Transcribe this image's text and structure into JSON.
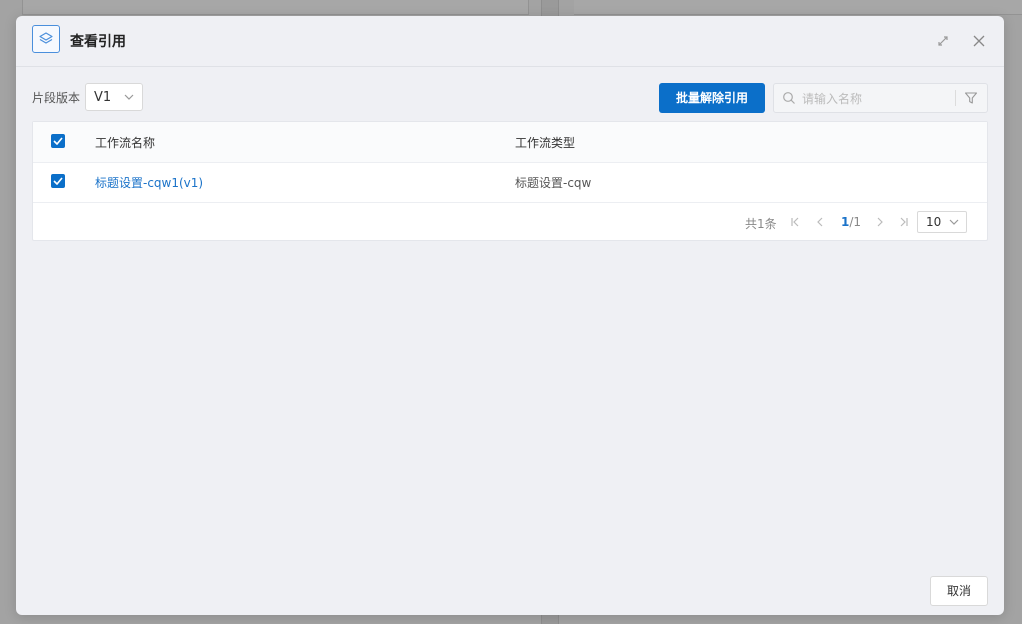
{
  "modal": {
    "title": "查看引用",
    "icon": "layers-icon",
    "accent_color": "#0b6fc9"
  },
  "toolbar": {
    "version_label": "片段版本",
    "version_value": "V1",
    "batch_remove_label": "批量解除引用",
    "search_placeholder": "请输入名称",
    "search_value": ""
  },
  "table": {
    "columns": [
      "工作流名称",
      "工作流类型"
    ],
    "header_checked": true,
    "rows": [
      {
        "checked": true,
        "name": "标题设置-cqw1(v1)",
        "type": "标题设置-cqw"
      }
    ]
  },
  "pagination": {
    "total_text": "共1条",
    "current_page": "1",
    "page_separator": "/1",
    "page_size": "10"
  },
  "footer": {
    "cancel_label": "取消"
  }
}
